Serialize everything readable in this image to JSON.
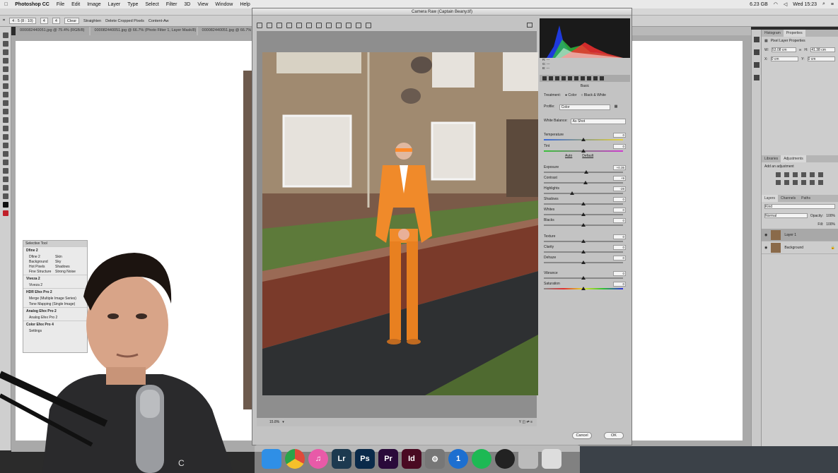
{
  "menubar": {
    "app": "Photoshop CC",
    "items": [
      "File",
      "Edit",
      "Image",
      "Layer",
      "Type",
      "Select",
      "Filter",
      "3D",
      "View",
      "Window",
      "Help"
    ],
    "storage": "6.23 GB",
    "time": "Wed 15:23"
  },
  "options_bar": {
    "ratio": "4 : 5 (8 : 10)",
    "value": "4",
    "clear": "Clear",
    "straighten": "Straighten",
    "delete_cropped": "Delete Cropped Pixels",
    "content_aware": "Content-Aw"
  },
  "doc_tabs": [
    "000082440051.jpg @ 75.4% (RGB/8)",
    "000082440051.jpg @ 66.7% (Photo Filter 1, Layer Mask/8)",
    "000082440051.jpg @ 66.7% (Layer"
  ],
  "nik": {
    "title": "Selective Tool",
    "dfine": "Dfine 2",
    "dfine_grid": [
      "Dfine 2",
      "Skin",
      "Background",
      "Sky",
      "Hot Pixels",
      "Shadows",
      "Fine Structure",
      "Strong Noise"
    ],
    "viveza_section": "Viveza 2",
    "viveza_item": "Viveza 2",
    "hdr_section": "HDR Efex Pro 2",
    "hdr_items": [
      "Merge (Multiple Image Series)",
      "Tone Mapping (Single Image)"
    ],
    "analog_section": "Analog Efex Pro 2",
    "analog_item": "Analog Efex Pro 2",
    "color_section": "Color Efex Pro 4",
    "settings": "Settings"
  },
  "camera_raw": {
    "title": "Camera Raw (Captain Beany.tif)",
    "histo_labels": [
      "R:",
      "G:",
      "B:"
    ],
    "histo_values": [
      "---",
      "---",
      "---"
    ],
    "panel_title": "Basic",
    "treatment_label": "Treatment:",
    "treatment_color": "Color",
    "treatment_bw": "Black & White",
    "profile_label": "Profile:",
    "profile_value": "Color",
    "wb_label": "White Balance:",
    "wb_value": "As Shot",
    "auto": "Auto",
    "default": "Default",
    "sliders": [
      {
        "label": "Temperature",
        "value": "0",
        "pos": 0.5
      },
      {
        "label": "Tint",
        "value": "0",
        "pos": 0.5
      },
      {
        "label": "Exposure",
        "value": "+0.35",
        "pos": 0.54
      },
      {
        "label": "Contrast",
        "value": "+9",
        "pos": 0.53
      },
      {
        "label": "Highlights",
        "value": "-28",
        "pos": 0.36
      },
      {
        "label": "Shadows",
        "value": "0",
        "pos": 0.5
      },
      {
        "label": "Whites",
        "value": "0",
        "pos": 0.5
      },
      {
        "label": "Blacks",
        "value": "0",
        "pos": 0.5
      },
      {
        "label": "Texture",
        "value": "0",
        "pos": 0.5
      },
      {
        "label": "Clarity",
        "value": "0",
        "pos": 0.5
      },
      {
        "label": "Dehaze",
        "value": "0",
        "pos": 0.5
      },
      {
        "label": "Vibrance",
        "value": "0",
        "pos": 0.5
      },
      {
        "label": "Saturation",
        "value": "0",
        "pos": 0.5
      }
    ],
    "zoom": "15.8%",
    "cancel": "Cancel",
    "ok": "OK"
  },
  "right_panel": {
    "tabs1": [
      "Histogram",
      "Properties"
    ],
    "props_title": "Pixel Layer Properties",
    "w_label": "W:",
    "w_value": "53.08 cm",
    "h_label": "H:",
    "h_value": "41.38 cm",
    "x_label": "X:",
    "x_value": "0 cm",
    "y_label": "Y:",
    "y_value": "0 cm",
    "tabs2": [
      "Libraries",
      "Adjustments"
    ],
    "add_adjustment": "Add an adjustment",
    "tabs3": [
      "Layers",
      "Channels",
      "Paths"
    ],
    "kind": "Kind",
    "blend": "Normal",
    "opacity_label": "Opacity:",
    "opacity": "100%",
    "fill_label": "Fill:",
    "fill": "100%",
    "layers": [
      "Layer 1",
      "Background"
    ]
  },
  "dock": {
    "apps": [
      {
        "name": "Finder",
        "label": "",
        "color": "#2f8fe6"
      },
      {
        "name": "Chrome",
        "label": "",
        "color": "#e04a3a"
      },
      {
        "name": "iTunes",
        "label": "♫",
        "color": "#e85aa8"
      },
      {
        "name": "Lightroom",
        "label": "Lr",
        "color": "#1d3a50"
      },
      {
        "name": "Photoshop",
        "label": "Ps",
        "color": "#0a2a4a"
      },
      {
        "name": "Premiere",
        "label": "Pr",
        "color": "#2a0a3a"
      },
      {
        "name": "InDesign",
        "label": "Id",
        "color": "#4a0a22"
      },
      {
        "name": "System Preferences",
        "label": "⚙",
        "color": "#777"
      },
      {
        "name": "1Password",
        "label": "1",
        "color": "#1d6fd0"
      },
      {
        "name": "Spotify",
        "label": "",
        "color": "#1db954"
      },
      {
        "name": "OBS",
        "label": "",
        "color": "#222"
      },
      {
        "name": "Preview",
        "label": "",
        "color": "#bbb"
      },
      {
        "name": "Trash",
        "label": "",
        "color": "#ddd"
      }
    ]
  }
}
